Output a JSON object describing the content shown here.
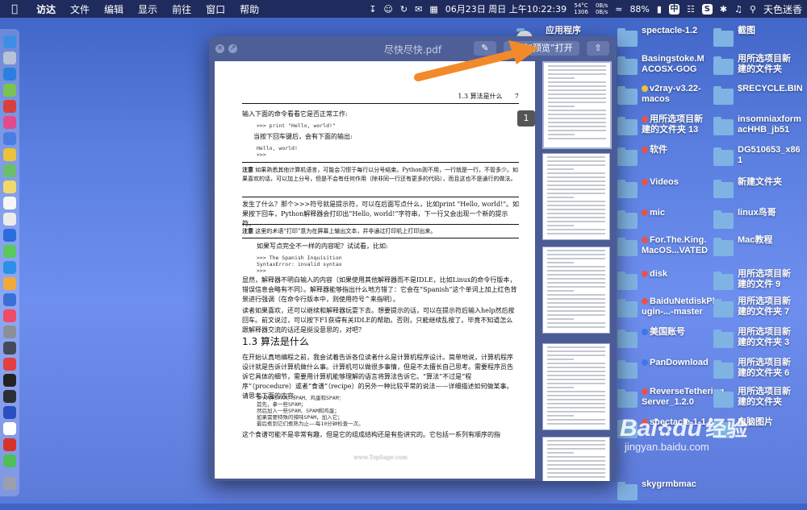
{
  "menubar": {
    "apple_icon": "apple-icon",
    "items": [
      "访达",
      "文件",
      "编辑",
      "显示",
      "前往",
      "窗口",
      "帮助"
    ],
    "temp_top": "54°C",
    "temp_bottom": "1306",
    "net_up": "0B/s",
    "net_down": "0B/s",
    "clock": "06月23日 周日 上午10:22:39",
    "battery": "88%",
    "input_method": "中",
    "sq_letter": "S",
    "user": "天色迷香"
  },
  "window": {
    "title": "尽快尽快.pdf",
    "open_with_button": "使用“预览”打开",
    "page_indicator": "1"
  },
  "document": {
    "header_section": "1.3    算法是什么",
    "header_page": "7",
    "p1": "输入下面的命令看看它是否正常工作:",
    "code1": ">>> print \"Hello, world!\"",
    "p2": "当按下回车键后，会有下面的输出:",
    "code2a": "Hello, world!",
    "code2b": ">>>",
    "note1_label": "注意",
    "note1_text": "如果熟悉其他计算机语言，可能会习惯于每行以分号结束。Python则不用，一行就是一行，不管多少。如果喜欢的话，可以加上分号，但是不会有任何作用（除非同一行还有更多的代码），而且这也不是通行的做法。",
    "p3": "发生了什么？那个>>>符号就是提示符，可以在后面写点什么，比如print \"Hello, world!\"。如果按下回车，Python解释器会打印出“Hello, world!”字符串，下一行又会出现一个新的提示符。",
    "note2_label": "注意",
    "note2_text": "这里的术语“打印”意为在屏幕上输出文本，并非通过打印机上打印出来。",
    "p4": "如果写点完全不一样的内容呢？试试看，比如:",
    "code3a": ">>> The Spanish Inquisition",
    "code3b": "SyntaxError: invalid syntax",
    "code3c": ">>>",
    "p5": "显然，解释器不明白输入的内容（如果使用其他解释器而不是IDLE，比如Linux的命令行版本，错误信息会略有不同）。解释器能够指出什么地方错了：它会在“Spanish”这个单词上加上红色背景进行强调（在命令行版本中，则使用符号^来指明）。",
    "p6": "读者如果喜欢，还可以继续和解释器玩耍下去。想要提示的话，可以在提示符后输入help然后按回车。前文说过，可以按下F1获得有关IDLE的帮助。否则，只能继续乱按了。毕竟不知道怎么跟解释器交流的话还是挺没意思的，对吧？",
    "section_title": "1.3   算法是什么",
    "p7": "在开始认真地编程之前，我会试着告诉各位读者什么是计算机程序设计。简单地说，计算机程序设计就是告诉计算机做什么事。计算机可以做很多事情，但是不太擅长自己思考。需要程序员告诉它具体的细节，需要用计算机能够理解的语言将算法告诉它。“算法”不过是“程序”（procedure）或者“食谱”（recipe）的另外一种比较平常的说法——详细描述如何做某事。请思考下面的内容:",
    "recipe1": "SPAM拌SPAM、SPAM、鸡蛋和SPAM：",
    "recipe2": "首先，拿一些SPAM；",
    "recipe3": "然后加入一些SPAM、SPAM和鸡蛋；",
    "recipe4": "如果需要特殊的辣味SPAM，加入它；",
    "recipe5": "最后煮到它们煮熟为止——每10分钟检查一次。",
    "p8": "这个食谱可能不是非常有趣，但是它的组成结构还是有些讲究的。它包括一系列有顺序的指",
    "footer_url": "www.TopSage.com"
  },
  "desktop": {
    "items": [
      {
        "label": "应用程序",
        "label2": ""
      },
      {
        "label": "spectacle-1.2",
        "label2": ""
      },
      {
        "label": "截图",
        "label2": ""
      },
      {
        "label": "Basingstoke.M",
        "label2": "ACOSX-GOG"
      },
      {
        "label": "用所选项目新",
        "label2": "建的文件夹"
      },
      {
        "label": "v2ray-v3.22-",
        "label2": "macos"
      },
      {
        "label": "$RECYCLE.BIN",
        "label2": ""
      },
      {
        "label": "用所选项目新",
        "label2": "建的文件夹 13"
      },
      {
        "label": "insomniaxform",
        "label2": "acHHB_jb51"
      },
      {
        "label": "软件",
        "label2": ""
      },
      {
        "label": "DG510653_x86",
        "label2": "1"
      },
      {
        "label": "Videos",
        "label2": ""
      },
      {
        "label": "新建文件夹",
        "label2": ""
      },
      {
        "label": "mic",
        "label2": ""
      },
      {
        "label": "linux鸟哥",
        "label2": ""
      },
      {
        "label": "For.The.King.",
        "label2": "MacOS...VATED"
      },
      {
        "label": "Mac教程",
        "label2": ""
      },
      {
        "label": "disk",
        "label2": ""
      },
      {
        "label": "用所选项目新",
        "label2": "建的文件 9"
      },
      {
        "label": "BaiduNetdiskPl",
        "label2": "ugin-...-master"
      },
      {
        "label": "用所选项目新",
        "label2": "建的文件夹 7"
      },
      {
        "label": "美国账号",
        "label2": ""
      },
      {
        "label": "用所选项目新",
        "label2": "建的文件夹 3"
      },
      {
        "label": "PanDownload",
        "label2": ""
      },
      {
        "label": "用所选项目新",
        "label2": "建的文件夹 6"
      },
      {
        "label": "ReverseTethering",
        "label2": "Server_1.2.0"
      },
      {
        "label": "用所选项目新",
        "label2": "建的文件夹"
      },
      {
        "label": "spectacle-1-1.2",
        "label2": ""
      },
      {
        "label": "电脑图片",
        "label2": ""
      },
      {
        "label": "skygrmbmac",
        "label2": ""
      }
    ]
  },
  "watermark": {
    "brand": "Bai",
    "brand2": "du",
    "suffix": "经验",
    "url": "jingyan.baidu.com"
  },
  "colors": {
    "arrow": "#f28a2a",
    "tag_red": "#e9524a",
    "tag_yellow": "#f3c03a",
    "tag_blue": "#3b78e7"
  }
}
